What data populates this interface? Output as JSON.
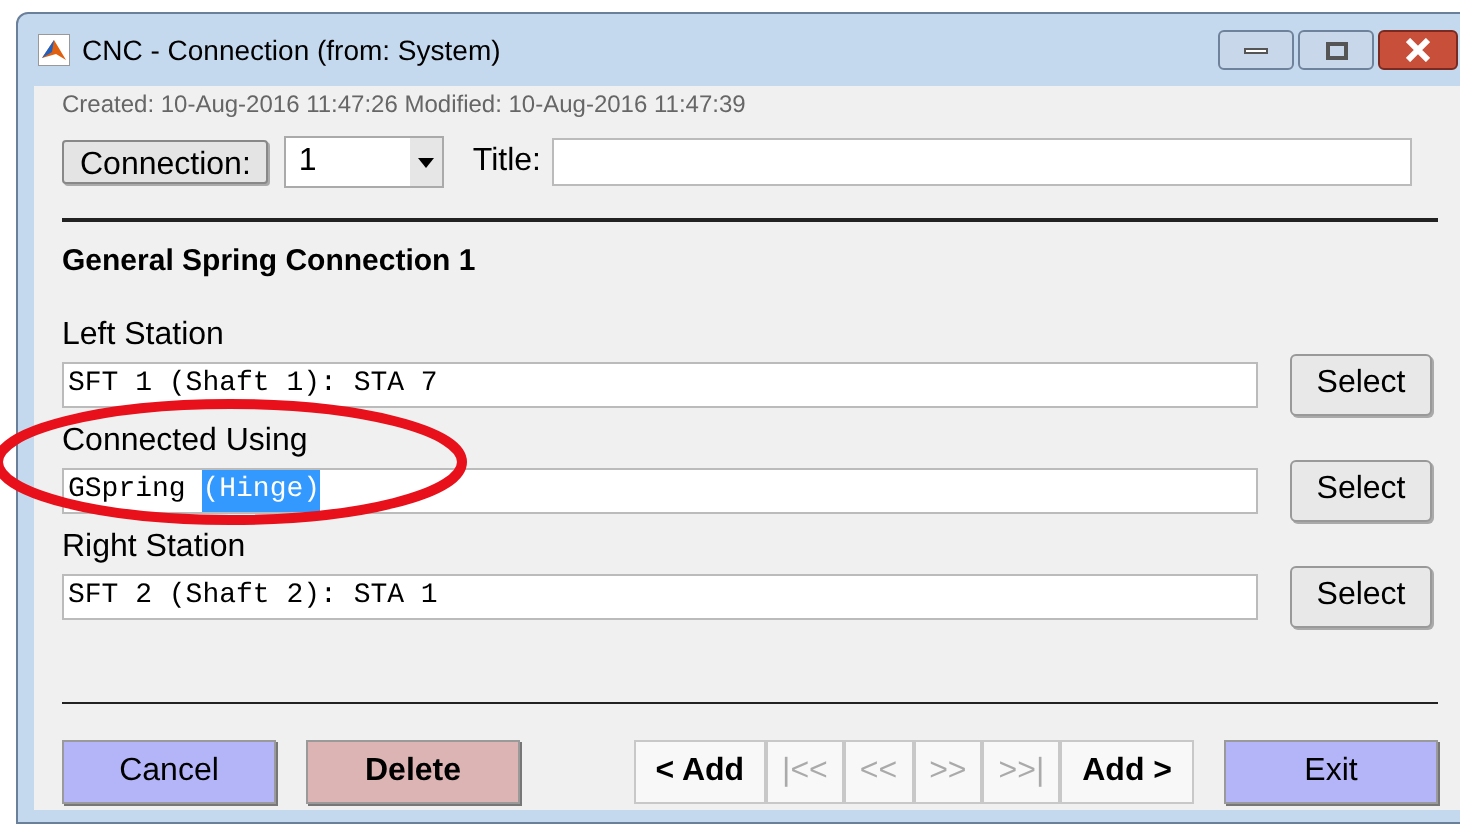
{
  "window": {
    "title": "CNC - Connection (from: System)"
  },
  "meta": "Created: 10-Aug-2016 11:47:26 Modified: 10-Aug-2016 11:47:39",
  "connection": {
    "button": "Connection:",
    "value": "1",
    "title_label": "Title:"
  },
  "heading": "General Spring Connection 1",
  "fields": [
    {
      "label": "Left Station",
      "value": "SFT 1 (Shaft 1): STA 7",
      "button": "Select",
      "annotated": false
    },
    {
      "label": "Connected Using",
      "value": "GSpring",
      "selected_text": "(Hinge)",
      "button": "Select",
      "annotated": true
    },
    {
      "label": "Right Station",
      "value": "SFT 2 (Shaft 2): STA 1",
      "button": "Select",
      "annotated": false
    }
  ],
  "footer_left": [
    {
      "label": "Cancel",
      "kind": "primary"
    },
    {
      "label": "Delete",
      "kind": "danger"
    }
  ],
  "nav": [
    {
      "label": "< Add",
      "disabled": false
    },
    {
      "label": "|<<",
      "disabled": true
    },
    {
      "label": "<<",
      "disabled": true
    },
    {
      "label": ">>",
      "disabled": true
    },
    {
      "label": ">>|",
      "disabled": true
    },
    {
      "label": "Add >",
      "disabled": false
    }
  ],
  "footer_right": [
    {
      "label": "Exit",
      "kind": "primary"
    }
  ]
}
